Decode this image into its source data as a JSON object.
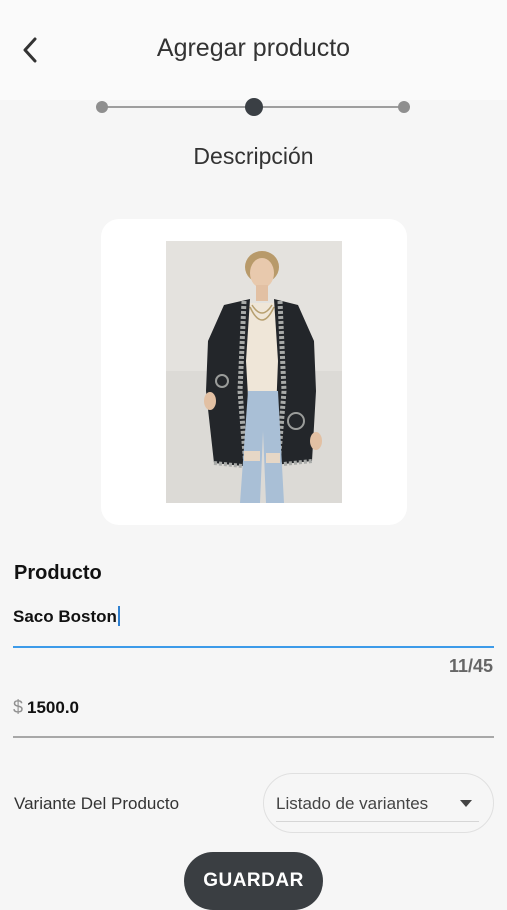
{
  "header": {
    "title": "Agregar producto",
    "back_icon": "arrow-back-icon"
  },
  "stepper": {
    "current_step": 2,
    "total_steps": 3,
    "step_label": "Descripción"
  },
  "product_image": {
    "alt": "product-photo"
  },
  "product_field": {
    "label": "Producto",
    "value": "Saco Boston",
    "counter": "11/45"
  },
  "price_field": {
    "prefix": "$",
    "value": "1500.0"
  },
  "variant": {
    "label": "Variante Del Producto",
    "dropdown_placeholder": "Listado de variantes"
  },
  "actions": {
    "save_label": "GUARDAR"
  },
  "colors": {
    "accent": "#3d9be9",
    "dark": "#3a3e42",
    "background": "#f6f6f6"
  }
}
